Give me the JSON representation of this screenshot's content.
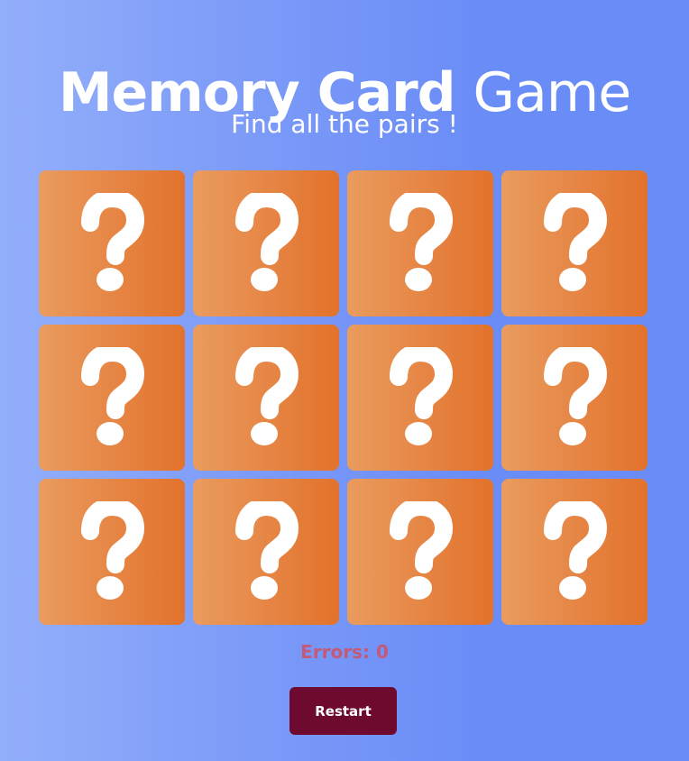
{
  "header": {
    "title_bold": "Memory Card",
    "title_light": "Game",
    "subtitle": "Find all the pairs !"
  },
  "board": {
    "rows": 3,
    "columns": 4,
    "cards": [
      {
        "face": "?"
      },
      {
        "face": "?"
      },
      {
        "face": "?"
      },
      {
        "face": "?"
      },
      {
        "face": "?"
      },
      {
        "face": "?"
      },
      {
        "face": "?"
      },
      {
        "face": "?"
      },
      {
        "face": "?"
      },
      {
        "face": "?"
      },
      {
        "face": "?"
      },
      {
        "face": "?"
      }
    ],
    "card_icon": "question-mark-icon"
  },
  "status": {
    "errors_label": "Errors: 0"
  },
  "controls": {
    "restart_label": "Restart"
  },
  "colors": {
    "card_start": "#e99c5e",
    "card_end": "#e2722b",
    "restart_bg": "#6e0a2f",
    "errors_text": "#c25a78"
  }
}
